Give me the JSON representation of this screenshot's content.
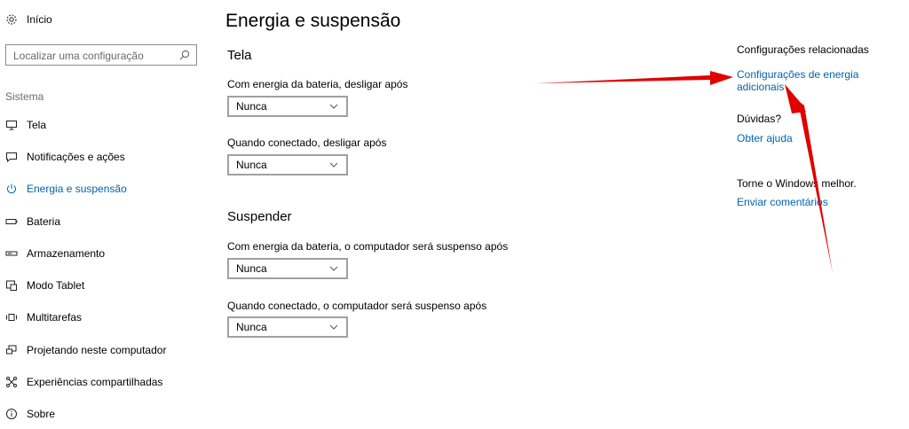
{
  "sidebar": {
    "home_label": "Início",
    "search_placeholder": "Localizar uma configuração",
    "section_label": "Sistema",
    "items": [
      {
        "label": "Tela",
        "icon": "monitor-icon"
      },
      {
        "label": "Notificações e ações",
        "icon": "notification-icon"
      },
      {
        "label": "Energia e suspensão",
        "icon": "power-icon",
        "active": true
      },
      {
        "label": "Bateria",
        "icon": "battery-icon"
      },
      {
        "label": "Armazenamento",
        "icon": "storage-icon"
      },
      {
        "label": "Modo Tablet",
        "icon": "tablet-mode-icon"
      },
      {
        "label": "Multitarefas",
        "icon": "multitasking-icon"
      },
      {
        "label": "Projetando neste computador",
        "icon": "projecting-icon"
      },
      {
        "label": "Experiências compartilhadas",
        "icon": "shared-experiences-icon"
      },
      {
        "label": "Sobre",
        "icon": "info-icon"
      }
    ]
  },
  "main": {
    "title": "Energia e suspensão",
    "screen": {
      "heading": "Tela",
      "battery_label": "Com energia da bateria, desligar após",
      "battery_value": "Nunca",
      "plugged_label": "Quando conectado, desligar após",
      "plugged_value": "Nunca"
    },
    "sleep": {
      "heading": "Suspender",
      "battery_label": "Com energia da bateria, o computador será suspenso após",
      "battery_value": "Nunca",
      "plugged_label": "Quando conectado, o computador será suspenso após",
      "plugged_value": "Nunca"
    }
  },
  "related": {
    "heading": "Configurações relacionadas",
    "power_link": "Configurações de energia adicionais",
    "questions_heading": "Dúvidas?",
    "help_link": "Obter ajuda",
    "feedback_heading": "Torne o Windows melhor.",
    "feedback_link": "Enviar comentários"
  },
  "colors": {
    "accent": "#0063b1",
    "annotation_arrow": "#e00000"
  }
}
